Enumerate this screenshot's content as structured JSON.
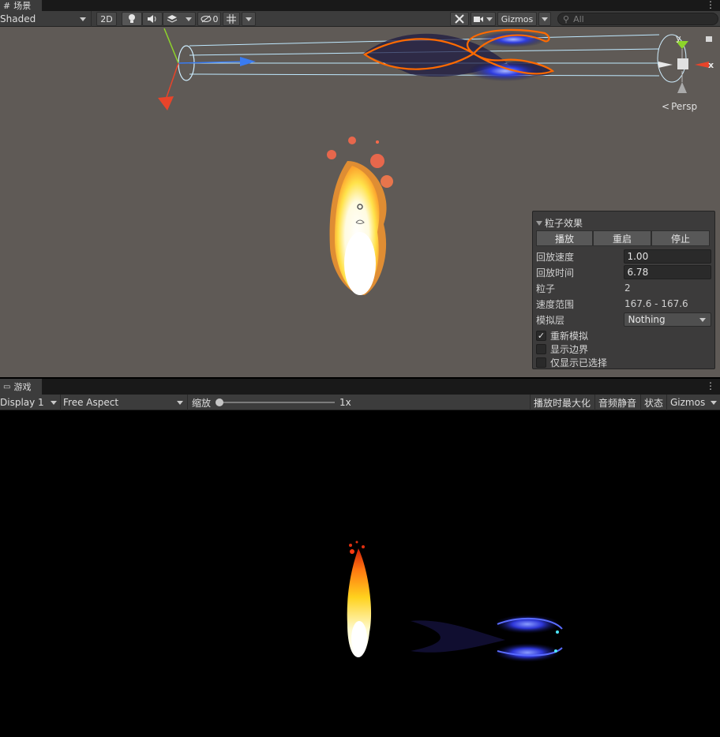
{
  "scene": {
    "tab_label": "场景",
    "tab_icon": "grid-icon",
    "shading_mode": "Shaded",
    "btn_2d": "2D",
    "hidden_count": "0",
    "gizmos_label": "Gizmos",
    "search_placeholder": "All",
    "persp_label": "Persp",
    "axis_y": "y",
    "axis_x": "x"
  },
  "particle_effect": {
    "title": "粒子效果",
    "play": "播放",
    "restart": "重启",
    "stop": "停止",
    "rows": [
      {
        "label": "回放速度",
        "value": "1.00"
      },
      {
        "label": "回放时间",
        "value": "6.78"
      },
      {
        "label": "粒子",
        "value": "2"
      },
      {
        "label": "速度范围",
        "value": "167.6 - 167.6"
      },
      {
        "label": "模拟层",
        "value": "Nothing"
      }
    ],
    "checks": [
      {
        "label": "重新模拟",
        "checked": true
      },
      {
        "label": "显示边界",
        "checked": false
      },
      {
        "label": "仅显示已选择",
        "checked": false
      }
    ]
  },
  "game": {
    "tab_label": "游戏",
    "tab_icon": "gamepad-icon",
    "display": "Display 1",
    "aspect": "Free Aspect",
    "scale_label": "缩放",
    "scale_value": "1x",
    "maximize_on_play": "播放时最大化",
    "mute_audio": "音频静音",
    "stats": "状态",
    "gizmos": "Gizmos"
  },
  "colors": {
    "editor_bg": "#3c3c3c",
    "scene_bg": "#5f5a56",
    "selection_outline": "#ff6a00",
    "axis_x": "#e8442a",
    "axis_y": "#8dd42a",
    "axis_z": "#3a7bf0"
  }
}
